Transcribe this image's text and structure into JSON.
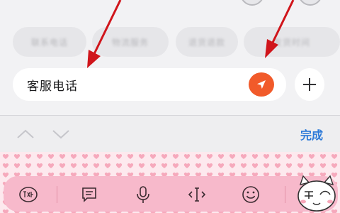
{
  "input": {
    "value": "客服电话"
  },
  "toolbar": {
    "done_label": "完成"
  },
  "quick_chips": [
    {
      "text": "联系电话"
    },
    {
      "text": "物流服务"
    },
    {
      "text": "退货退款"
    },
    {
      "text": "发货时间"
    }
  ],
  "colors": {
    "send_button": "#f15a2a",
    "done_text": "#2f7bd8",
    "keyboard_bar": "#f7b9cb",
    "annotation_arrow": "#d0151b"
  },
  "icons": {
    "send": "paper-plane-icon",
    "plus": "plus-icon",
    "prev": "chevron-up-icon",
    "next": "chevron-down-icon",
    "kb_left": "language-switch-icon",
    "kb_1": "message-icon",
    "kb_2": "microphone-icon",
    "kb_3": "cursor-icon",
    "kb_4": "emoji-icon"
  }
}
